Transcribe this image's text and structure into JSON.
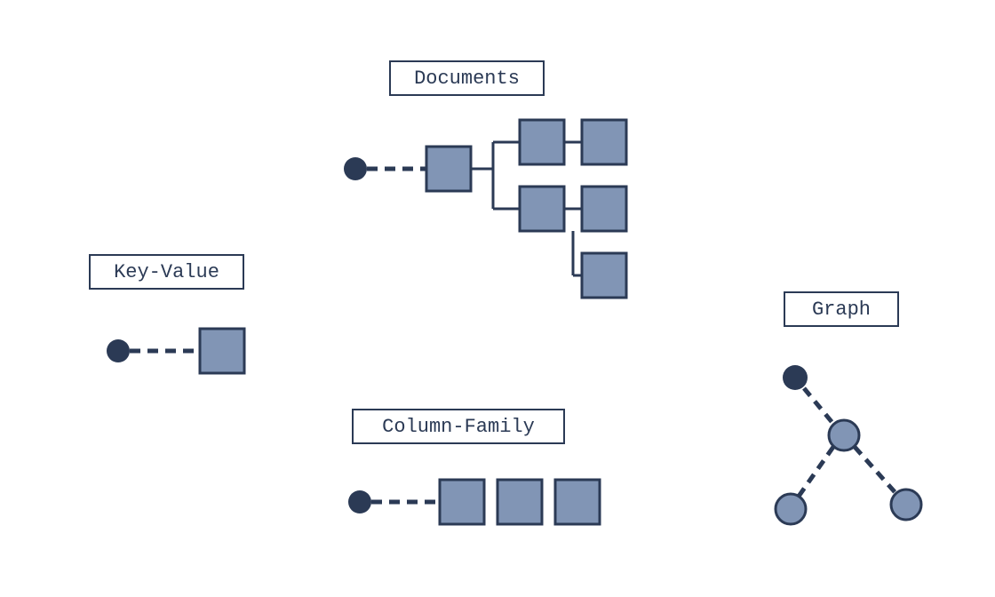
{
  "colors": {
    "dark": "#2b3a55",
    "light": "#8195b5",
    "border": "#2b3a55"
  },
  "labels": {
    "documents": "Documents",
    "key_value": "Key-Value",
    "column_family": "Column-Family",
    "graph": "Graph"
  },
  "diagram": {
    "types": [
      "Key-Value",
      "Documents",
      "Column-Family",
      "Graph"
    ],
    "description": "Four NoSQL database model illustrations: key-value (single key to single value box), documents (key to nested/linked boxes), column-family (key to row of boxes), and graph (nodes connected by edges)."
  }
}
